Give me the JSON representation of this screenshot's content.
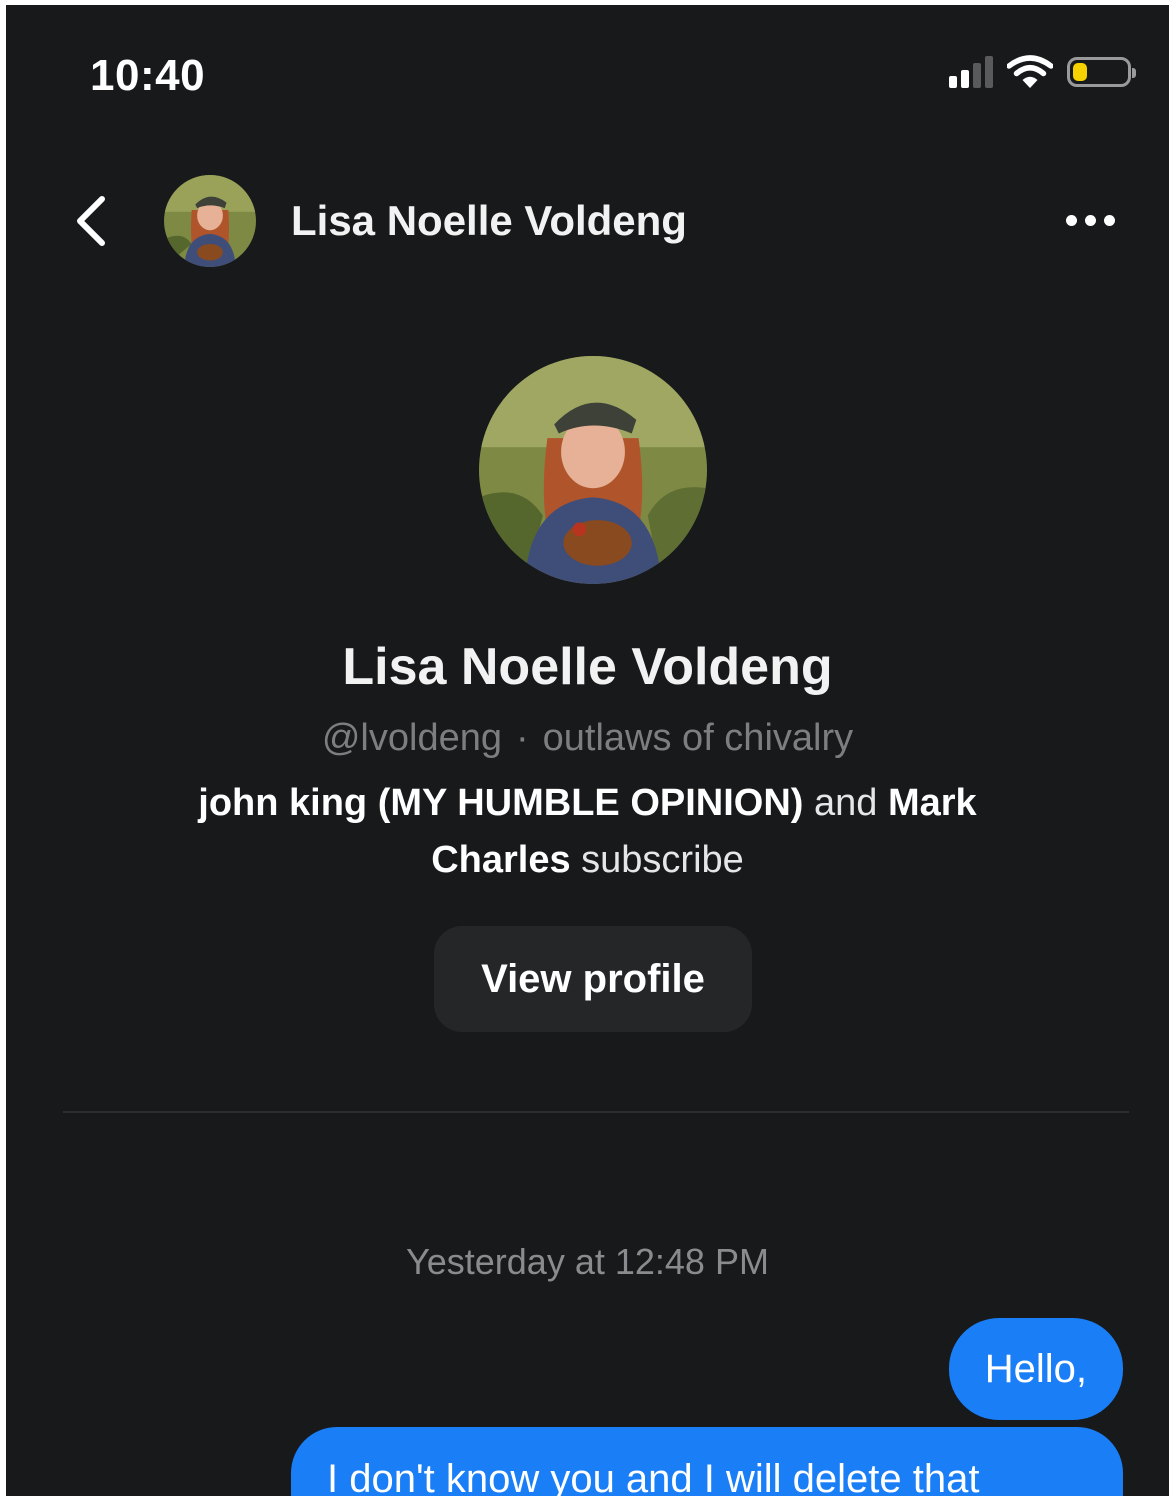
{
  "status_bar": {
    "time": "10:40",
    "icons": [
      "cellular-signal-icon",
      "wifi-icon",
      "battery-icon"
    ],
    "battery_color": "#f5d200"
  },
  "header": {
    "back_icon": "chevron-left-icon",
    "name": "Lisa Noelle Voldeng",
    "more_icon": "ellipsis-icon"
  },
  "profile": {
    "name": "Lisa Noelle Voldeng",
    "handle": "@lvoldeng",
    "separator": "·",
    "publication": "outlaws of chivalry",
    "subscriber_1": "john king (MY HUMBLE OPINION)",
    "conjunction": "and",
    "subscriber_2": "Mark Charles",
    "subscribe_suffix": "subscribe",
    "view_profile_label": "View profile"
  },
  "messages": {
    "timestamp": "Yesterday at 12:48 PM",
    "items": [
      {
        "text": "Hello,",
        "sender": "me"
      },
      {
        "text": "I don't know you and I will delete that",
        "sender": "me"
      }
    ]
  },
  "colors": {
    "background": "#18191b",
    "bubble": "#1a7ef7",
    "button": "#252628"
  }
}
